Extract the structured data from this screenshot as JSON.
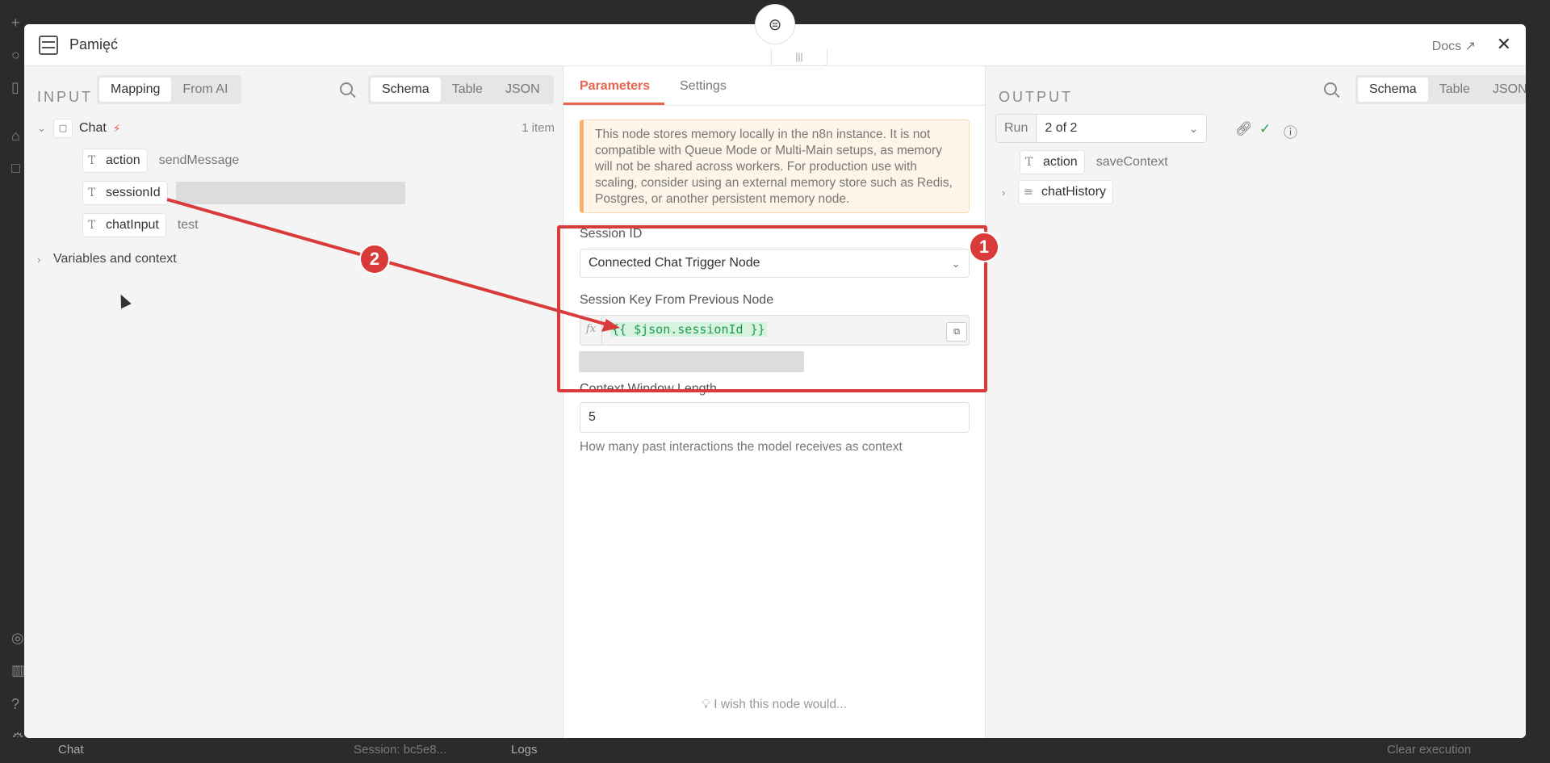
{
  "node": {
    "title": "Pamięć",
    "docs_label": "Docs",
    "close_icon": "close-icon"
  },
  "input": {
    "label": "INPUT",
    "mode_tabs": [
      "Mapping",
      "From AI"
    ],
    "view_tabs": [
      "Schema",
      "Table",
      "JSON"
    ],
    "source": {
      "name": "Chat",
      "count": "1 item"
    },
    "fields": [
      {
        "name": "action",
        "value": "sendMessage"
      },
      {
        "name": "sessionId",
        "value": ""
      },
      {
        "name": "chatInput",
        "value": "test"
      }
    ],
    "variables_label": "Variables and context"
  },
  "parameters": {
    "tabs": [
      "Parameters",
      "Settings"
    ],
    "notice": "This node stores memory locally in the n8n instance. It is not compatible with Queue Mode or Multi-Main setups, as memory will not be shared across workers. For production use with scaling, consider using an external memory store such as Redis, Postgres, or another persistent memory node.",
    "session_id_label": "Session ID",
    "session_id_value": "Connected Chat Trigger Node",
    "session_key_label": "Session Key From Previous Node",
    "session_key_expression": "{{ $json.sessionId }}",
    "context_window_label": "Context Window Length",
    "context_window_value": "5",
    "context_window_hint": "How many past interactions the model receives as context",
    "wish_label": "I wish this node would..."
  },
  "output": {
    "label": "OUTPUT",
    "view_tabs": [
      "Schema",
      "Table",
      "JSON"
    ],
    "run_label": "Run",
    "run_value": "2 of 2",
    "fields": [
      {
        "name": "action",
        "value": "saveContext"
      },
      {
        "name": "chatHistory",
        "value": ""
      }
    ]
  },
  "background": {
    "chat_label": "Chat",
    "session_label": "Session: bc5e8...",
    "logs_label": "Logs",
    "clear_label": "Clear execution"
  },
  "annotations": {
    "marker_1": "1",
    "marker_2": "2"
  },
  "colors": {
    "accent": "#e8644f",
    "annotation": "#d93b3b",
    "expression": "#1b9d4f"
  }
}
